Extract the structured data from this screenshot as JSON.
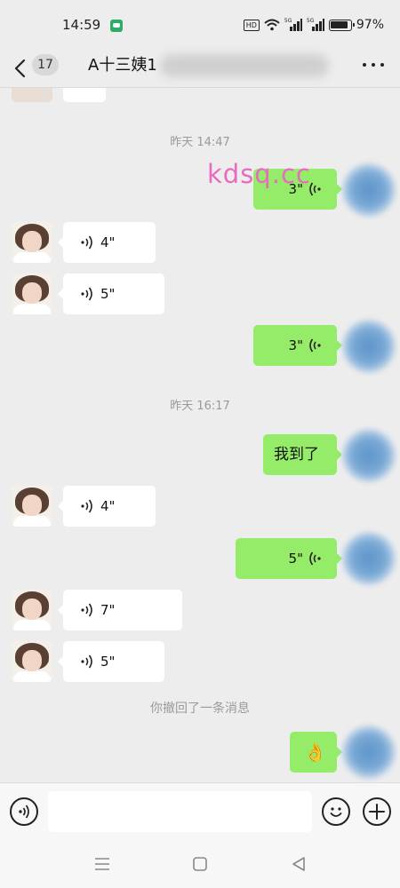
{
  "status_bar": {
    "time": "14:59",
    "hd_label": "HD",
    "network_label": "5G",
    "battery": "97%"
  },
  "nav": {
    "unread_count": "17",
    "chat_title": "A十三姨1",
    "icons": [
      "back-arrow-icon",
      "more-icon"
    ]
  },
  "watermark": "kdsq.cc",
  "messages": {
    "timestamp_1": "昨天 14:47",
    "timestamp_2": "昨天 16:17",
    "recall_notice": "你撤回了一条消息",
    "m1_duration": "3\"",
    "m2_duration": "4\"",
    "m3_duration": "5\"",
    "m4_duration": "3\"",
    "m5_text": "我到了",
    "m6_duration": "4\"",
    "m7_duration": "5\"",
    "m8_duration": "7\"",
    "m9_duration": "5\"",
    "m10_emoji": "👌"
  },
  "input_bar": {
    "placeholder": "",
    "icons": [
      "voice-toggle-icon",
      "emoji-icon",
      "plus-icon"
    ]
  },
  "system_nav": {
    "icons": [
      "menu-icon",
      "home-icon",
      "back-triangle-icon"
    ]
  },
  "colors": {
    "background": "#ededed",
    "outgoing_bubble": "#95ec69",
    "incoming_bubble": "#ffffff",
    "timestamp_text": "#9a9a9a",
    "watermark": "#e86bbf"
  }
}
